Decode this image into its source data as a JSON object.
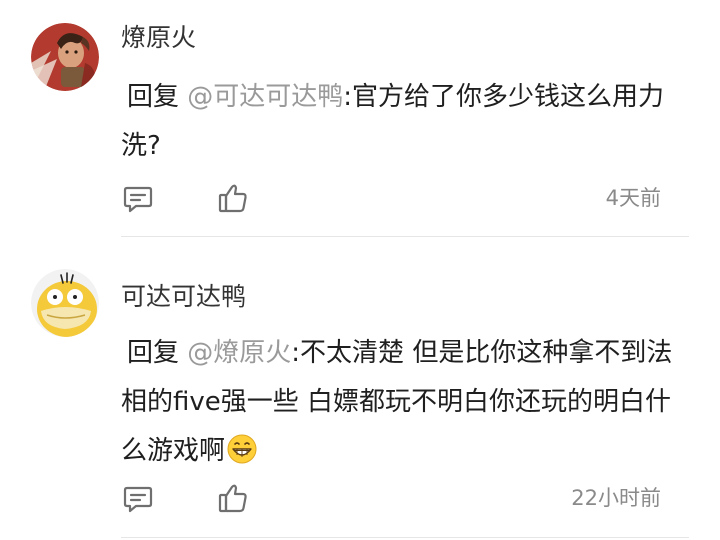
{
  "comments": [
    {
      "username": "燎原火",
      "avatar": "warrior-avatar",
      "reply_prefix": "回复",
      "mention": "@可达可达鸭",
      "text": ":官方给了你多少钱这么用力洗?",
      "emoji": "",
      "timestamp": "4天前"
    },
    {
      "username": "可达可达鸭",
      "avatar": "yellow-duck-avatar",
      "reply_prefix": "回复",
      "mention": "@燎原火",
      "text": ":不太清楚 但是比你这种拿不到法相的five强一些 白嫖都玩不明白你还玩的明白什么游戏啊",
      "emoji": "grinning-face-emoji",
      "timestamp": "22小时前"
    }
  ],
  "icons": {
    "comment": "comment-bubble-icon",
    "like": "thumbs-up-icon"
  },
  "colors": {
    "mention": "#9a9a9a",
    "timestamp": "#8a8a8a",
    "icon_stroke": "#6f6f6f",
    "divider": "#e6e6e6"
  }
}
